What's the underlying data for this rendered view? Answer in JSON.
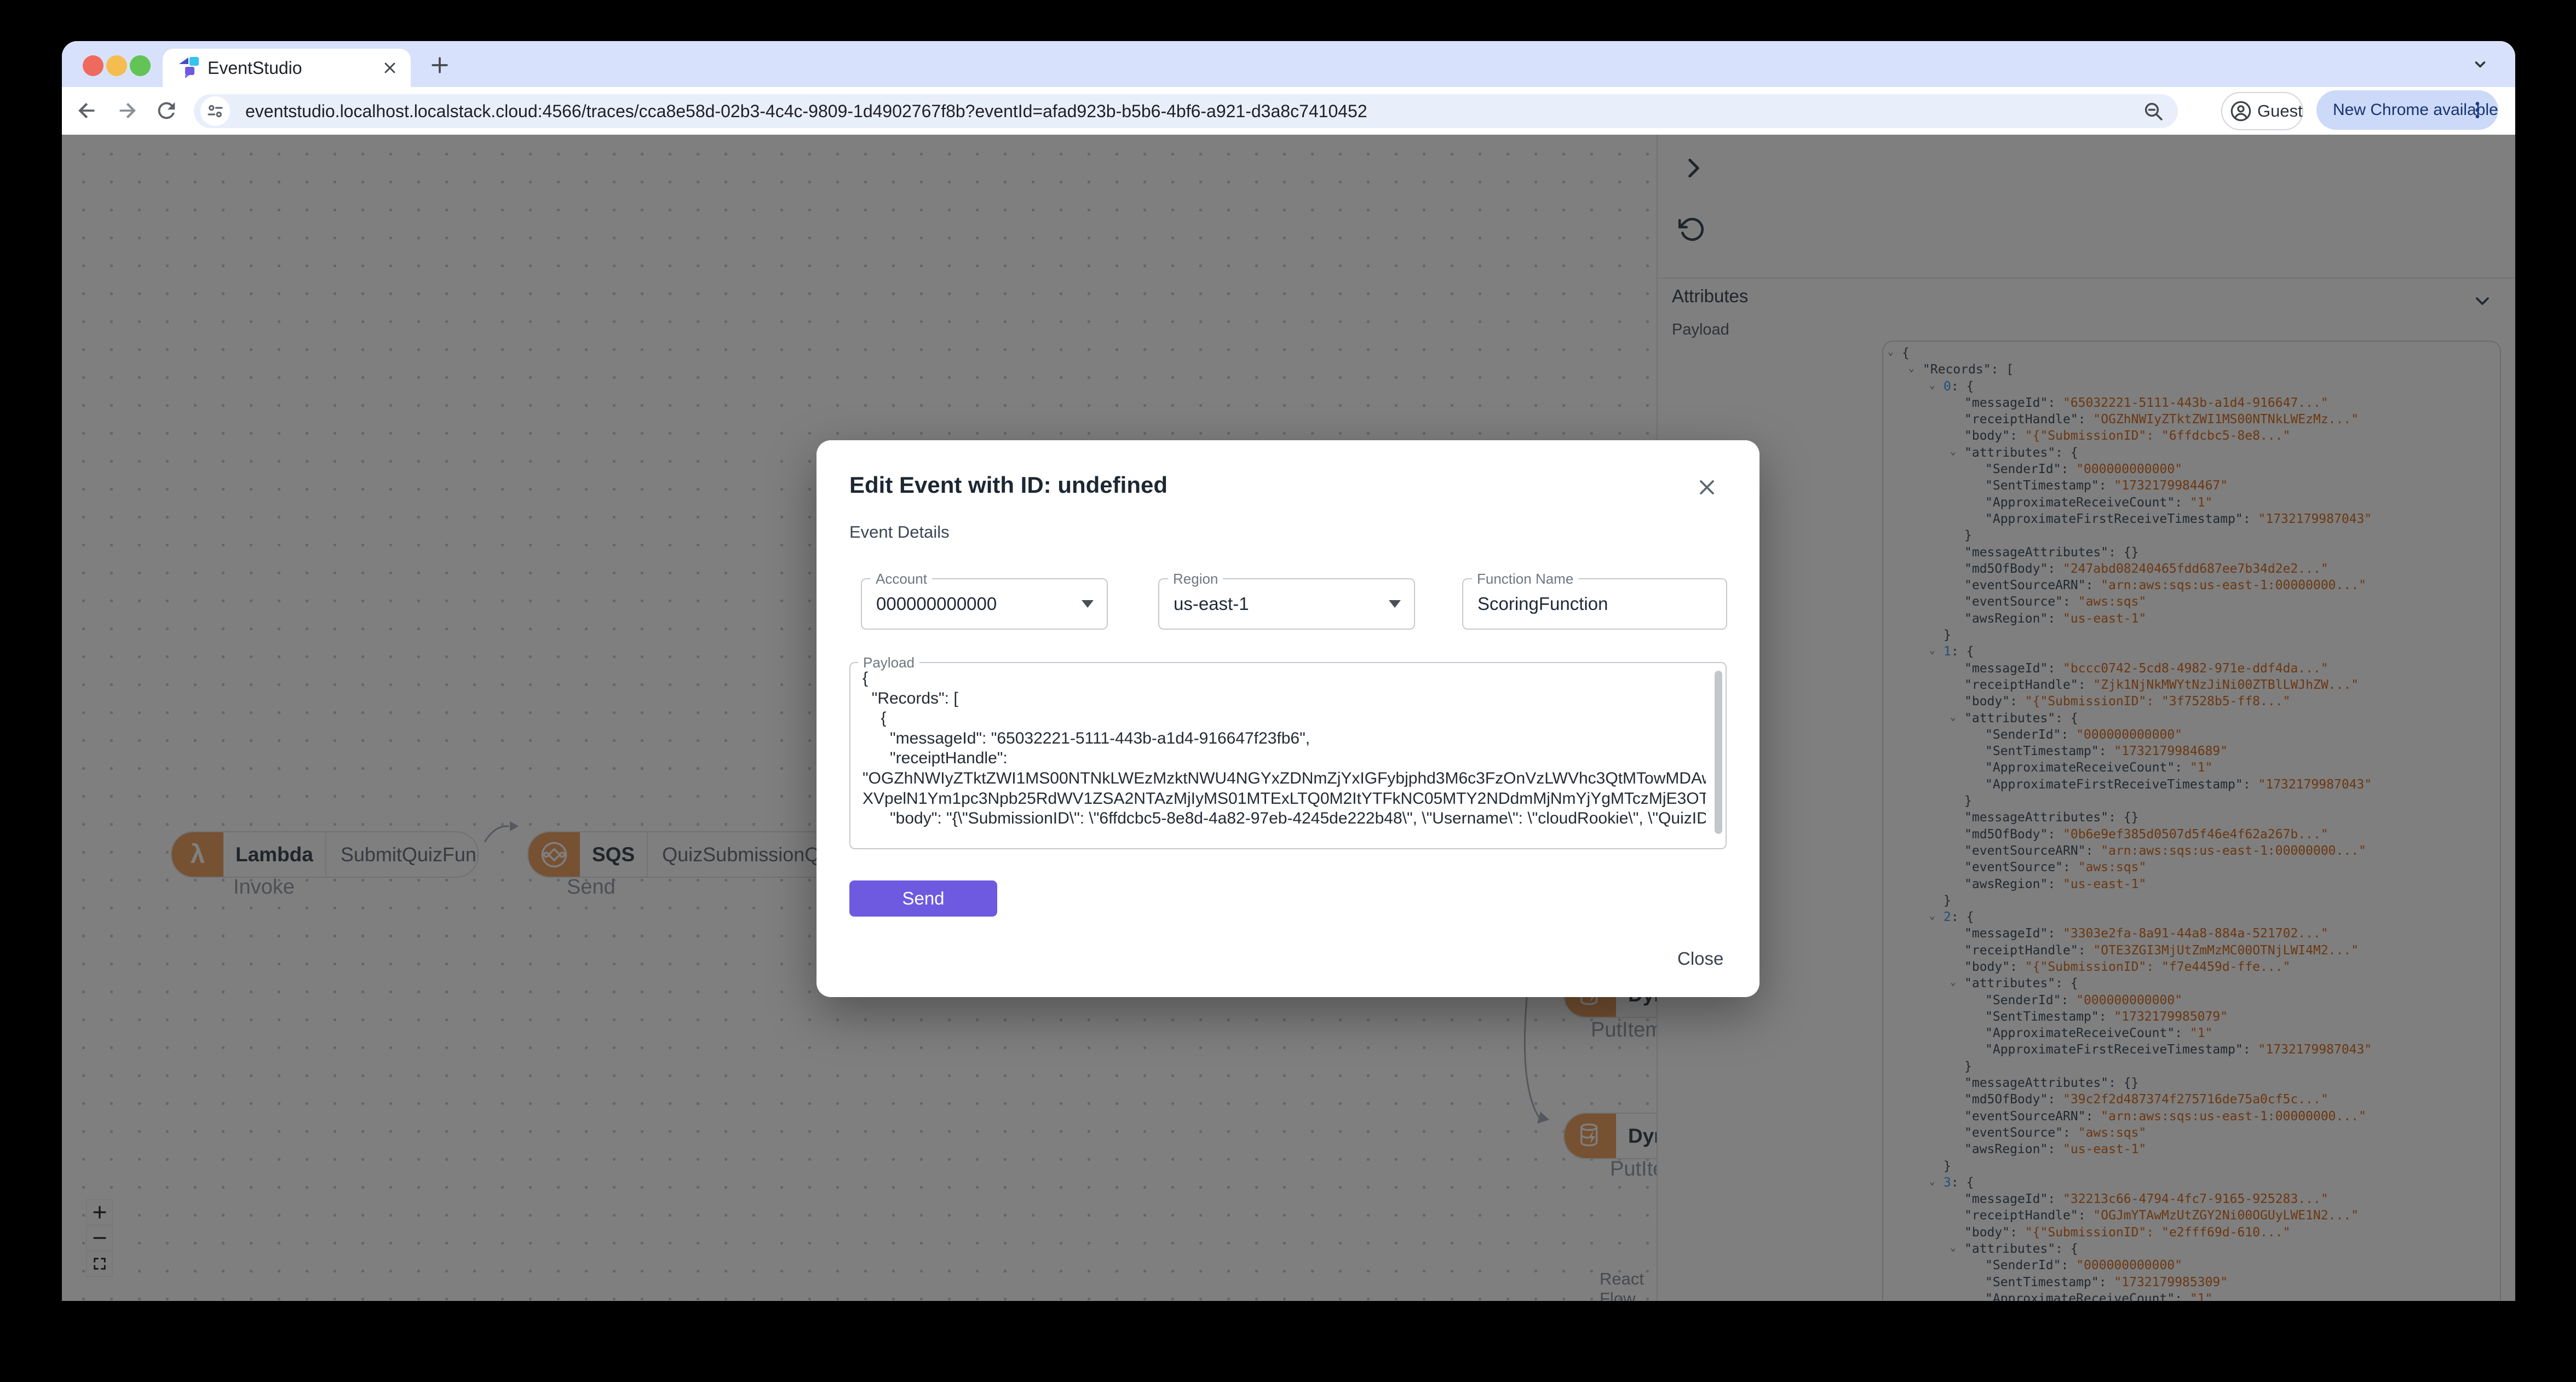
{
  "browser": {
    "tab_title": "EventStudio",
    "url": "eventstudio.localhost.localstack.cloud:4566/traces/cca8e58d-02b3-4c4c-9809-1d4902767f8b?eventId=afad923b-b5b6-4bf6-a921-d3a8c7410452",
    "profile_label": "Guest",
    "update_label": "New Chrome available"
  },
  "canvas": {
    "attribution": "React Flow",
    "nodes": [
      {
        "service": "Lambda",
        "name": "SubmitQuizFunction",
        "action": "Invoke"
      },
      {
        "service": "SQS",
        "name": "QuizSubmissionQueue",
        "action": "Send"
      },
      {
        "service": "DynamoDB",
        "name": "",
        "action": "PutItem"
      },
      {
        "service": "DynamoDB",
        "name": "",
        "action": "PutItem"
      }
    ]
  },
  "panel": {
    "attributes_label": "Attributes",
    "payload_label": "Payload",
    "json_lines": [
      {
        "ind": 0,
        "caret": true,
        "seg": [
          [
            "{",
            "b"
          ]
        ]
      },
      {
        "ind": 1,
        "caret": true,
        "seg": [
          [
            "\"Records\"",
            "k"
          ],
          [
            ": ",
            "p"
          ],
          [
            "[",
            "b"
          ]
        ]
      },
      {
        "ind": 2,
        "caret": true,
        "seg": [
          [
            "0",
            "i"
          ],
          [
            ": ",
            "p"
          ],
          [
            "{",
            "b"
          ]
        ]
      },
      {
        "ind": 3,
        "caret": false,
        "seg": [
          [
            "\"messageId\"",
            "k"
          ],
          [
            ": ",
            "p"
          ],
          [
            "\"65032221-5111-443b-a1d4-916647...\"",
            "v"
          ]
        ]
      },
      {
        "ind": 3,
        "caret": false,
        "seg": [
          [
            "\"receiptHandle\"",
            "k"
          ],
          [
            ": ",
            "p"
          ],
          [
            "\"OGZhNWIyZTktZWI1MS00NTNkLWEzMz...\"",
            "v"
          ]
        ]
      },
      {
        "ind": 3,
        "caret": false,
        "seg": [
          [
            "\"body\"",
            "k"
          ],
          [
            ": ",
            "p"
          ],
          [
            "\"{\"SubmissionID\": \"6ffdcbc5-8e8...\"",
            "v"
          ]
        ]
      },
      {
        "ind": 3,
        "caret": true,
        "seg": [
          [
            "\"attributes\"",
            "k"
          ],
          [
            ": ",
            "p"
          ],
          [
            "{",
            "b"
          ]
        ]
      },
      {
        "ind": 4,
        "caret": false,
        "seg": [
          [
            "\"SenderId\"",
            "k"
          ],
          [
            ": ",
            "p"
          ],
          [
            "\"000000000000\"",
            "v"
          ]
        ]
      },
      {
        "ind": 4,
        "caret": false,
        "seg": [
          [
            "\"SentTimestamp\"",
            "k"
          ],
          [
            ": ",
            "p"
          ],
          [
            "\"1732179984467\"",
            "v"
          ]
        ]
      },
      {
        "ind": 4,
        "caret": false,
        "seg": [
          [
            "\"ApproximateReceiveCount\"",
            "k"
          ],
          [
            ": ",
            "p"
          ],
          [
            "\"1\"",
            "v"
          ]
        ]
      },
      {
        "ind": 4,
        "caret": false,
        "seg": [
          [
            "\"ApproximateFirstReceiveTimestamp\"",
            "k"
          ],
          [
            ": ",
            "p"
          ],
          [
            "\"1732179987043\"",
            "v"
          ]
        ]
      },
      {
        "ind": 3,
        "caret": false,
        "seg": [
          [
            "}",
            "b"
          ]
        ]
      },
      {
        "ind": 3,
        "caret": false,
        "seg": [
          [
            "\"messageAttributes\"",
            "k"
          ],
          [
            ": ",
            "p"
          ],
          [
            "{}",
            "b"
          ]
        ]
      },
      {
        "ind": 3,
        "caret": false,
        "seg": [
          [
            "\"md5OfBody\"",
            "k"
          ],
          [
            ": ",
            "p"
          ],
          [
            "\"247abd08240465fdd687ee7b34d2e2...\"",
            "v"
          ]
        ]
      },
      {
        "ind": 3,
        "caret": false,
        "seg": [
          [
            "\"eventSourceARN\"",
            "k"
          ],
          [
            ": ",
            "p"
          ],
          [
            "\"arn:aws:sqs:us-east-1:00000000...\"",
            "v"
          ]
        ]
      },
      {
        "ind": 3,
        "caret": false,
        "seg": [
          [
            "\"eventSource\"",
            "k"
          ],
          [
            ": ",
            "p"
          ],
          [
            "\"aws:sqs\"",
            "v"
          ]
        ]
      },
      {
        "ind": 3,
        "caret": false,
        "seg": [
          [
            "\"awsRegion\"",
            "k"
          ],
          [
            ": ",
            "p"
          ],
          [
            "\"us-east-1\"",
            "v"
          ]
        ]
      },
      {
        "ind": 2,
        "caret": false,
        "seg": [
          [
            "}",
            "b"
          ]
        ]
      },
      {
        "ind": 2,
        "caret": true,
        "seg": [
          [
            "1",
            "i"
          ],
          [
            ": ",
            "p"
          ],
          [
            "{",
            "b"
          ]
        ]
      },
      {
        "ind": 3,
        "caret": false,
        "seg": [
          [
            "\"messageId\"",
            "k"
          ],
          [
            ": ",
            "p"
          ],
          [
            "\"bccc0742-5cd8-4982-971e-ddf4da...\"",
            "v"
          ]
        ]
      },
      {
        "ind": 3,
        "caret": false,
        "seg": [
          [
            "\"receiptHandle\"",
            "k"
          ],
          [
            ": ",
            "p"
          ],
          [
            "\"Zjk1NjNkMWYtNzJiNi00ZTBlLWJhZW...\"",
            "v"
          ]
        ]
      },
      {
        "ind": 3,
        "caret": false,
        "seg": [
          [
            "\"body\"",
            "k"
          ],
          [
            ": ",
            "p"
          ],
          [
            "\"{\"SubmissionID\": \"3f7528b5-ff8...\"",
            "v"
          ]
        ]
      },
      {
        "ind": 3,
        "caret": true,
        "seg": [
          [
            "\"attributes\"",
            "k"
          ],
          [
            ": ",
            "p"
          ],
          [
            "{",
            "b"
          ]
        ]
      },
      {
        "ind": 4,
        "caret": false,
        "seg": [
          [
            "\"SenderId\"",
            "k"
          ],
          [
            ": ",
            "p"
          ],
          [
            "\"000000000000\"",
            "v"
          ]
        ]
      },
      {
        "ind": 4,
        "caret": false,
        "seg": [
          [
            "\"SentTimestamp\"",
            "k"
          ],
          [
            ": ",
            "p"
          ],
          [
            "\"1732179984689\"",
            "v"
          ]
        ]
      },
      {
        "ind": 4,
        "caret": false,
        "seg": [
          [
            "\"ApproximateReceiveCount\"",
            "k"
          ],
          [
            ": ",
            "p"
          ],
          [
            "\"1\"",
            "v"
          ]
        ]
      },
      {
        "ind": 4,
        "caret": false,
        "seg": [
          [
            "\"ApproximateFirstReceiveTimestamp\"",
            "k"
          ],
          [
            ": ",
            "p"
          ],
          [
            "\"1732179987043\"",
            "v"
          ]
        ]
      },
      {
        "ind": 3,
        "caret": false,
        "seg": [
          [
            "}",
            "b"
          ]
        ]
      },
      {
        "ind": 3,
        "caret": false,
        "seg": [
          [
            "\"messageAttributes\"",
            "k"
          ],
          [
            ": ",
            "p"
          ],
          [
            "{}",
            "b"
          ]
        ]
      },
      {
        "ind": 3,
        "caret": false,
        "seg": [
          [
            "\"md5OfBody\"",
            "k"
          ],
          [
            ": ",
            "p"
          ],
          [
            "\"0b6e9ef385d0507d5f46e4f62a267b...\"",
            "v"
          ]
        ]
      },
      {
        "ind": 3,
        "caret": false,
        "seg": [
          [
            "\"eventSourceARN\"",
            "k"
          ],
          [
            ": ",
            "p"
          ],
          [
            "\"arn:aws:sqs:us-east-1:00000000...\"",
            "v"
          ]
        ]
      },
      {
        "ind": 3,
        "caret": false,
        "seg": [
          [
            "\"eventSource\"",
            "k"
          ],
          [
            ": ",
            "p"
          ],
          [
            "\"aws:sqs\"",
            "v"
          ]
        ]
      },
      {
        "ind": 3,
        "caret": false,
        "seg": [
          [
            "\"awsRegion\"",
            "k"
          ],
          [
            ": ",
            "p"
          ],
          [
            "\"us-east-1\"",
            "v"
          ]
        ]
      },
      {
        "ind": 2,
        "caret": false,
        "seg": [
          [
            "}",
            "b"
          ]
        ]
      },
      {
        "ind": 2,
        "caret": true,
        "seg": [
          [
            "2",
            "i"
          ],
          [
            ": ",
            "p"
          ],
          [
            "{",
            "b"
          ]
        ]
      },
      {
        "ind": 3,
        "caret": false,
        "seg": [
          [
            "\"messageId\"",
            "k"
          ],
          [
            ": ",
            "p"
          ],
          [
            "\"3303e2fa-8a91-44a8-884a-521702...\"",
            "v"
          ]
        ]
      },
      {
        "ind": 3,
        "caret": false,
        "seg": [
          [
            "\"receiptHandle\"",
            "k"
          ],
          [
            ": ",
            "p"
          ],
          [
            "\"OTE3ZGI3MjUtZmMzMC00OTNjLWI4M2...\"",
            "v"
          ]
        ]
      },
      {
        "ind": 3,
        "caret": false,
        "seg": [
          [
            "\"body\"",
            "k"
          ],
          [
            ": ",
            "p"
          ],
          [
            "\"{\"SubmissionID\": \"f7e4459d-ffe...\"",
            "v"
          ]
        ]
      },
      {
        "ind": 3,
        "caret": true,
        "seg": [
          [
            "\"attributes\"",
            "k"
          ],
          [
            ": ",
            "p"
          ],
          [
            "{",
            "b"
          ]
        ]
      },
      {
        "ind": 4,
        "caret": false,
        "seg": [
          [
            "\"SenderId\"",
            "k"
          ],
          [
            ": ",
            "p"
          ],
          [
            "\"000000000000\"",
            "v"
          ]
        ]
      },
      {
        "ind": 4,
        "caret": false,
        "seg": [
          [
            "\"SentTimestamp\"",
            "k"
          ],
          [
            ": ",
            "p"
          ],
          [
            "\"1732179985079\"",
            "v"
          ]
        ]
      },
      {
        "ind": 4,
        "caret": false,
        "seg": [
          [
            "\"ApproximateReceiveCount\"",
            "k"
          ],
          [
            ": ",
            "p"
          ],
          [
            "\"1\"",
            "v"
          ]
        ]
      },
      {
        "ind": 4,
        "caret": false,
        "seg": [
          [
            "\"ApproximateFirstReceiveTimestamp\"",
            "k"
          ],
          [
            ": ",
            "p"
          ],
          [
            "\"1732179987043\"",
            "v"
          ]
        ]
      },
      {
        "ind": 3,
        "caret": false,
        "seg": [
          [
            "}",
            "b"
          ]
        ]
      },
      {
        "ind": 3,
        "caret": false,
        "seg": [
          [
            "\"messageAttributes\"",
            "k"
          ],
          [
            ": ",
            "p"
          ],
          [
            "{}",
            "b"
          ]
        ]
      },
      {
        "ind": 3,
        "caret": false,
        "seg": [
          [
            "\"md5OfBody\"",
            "k"
          ],
          [
            ": ",
            "p"
          ],
          [
            "\"39c2f2d487374f275716de75a0cf5c...\"",
            "v"
          ]
        ]
      },
      {
        "ind": 3,
        "caret": false,
        "seg": [
          [
            "\"eventSourceARN\"",
            "k"
          ],
          [
            ": ",
            "p"
          ],
          [
            "\"arn:aws:sqs:us-east-1:00000000...\"",
            "v"
          ]
        ]
      },
      {
        "ind": 3,
        "caret": false,
        "seg": [
          [
            "\"eventSource\"",
            "k"
          ],
          [
            ": ",
            "p"
          ],
          [
            "\"aws:sqs\"",
            "v"
          ]
        ]
      },
      {
        "ind": 3,
        "caret": false,
        "seg": [
          [
            "\"awsRegion\"",
            "k"
          ],
          [
            ": ",
            "p"
          ],
          [
            "\"us-east-1\"",
            "v"
          ]
        ]
      },
      {
        "ind": 2,
        "caret": false,
        "seg": [
          [
            "}",
            "b"
          ]
        ]
      },
      {
        "ind": 2,
        "caret": true,
        "seg": [
          [
            "3",
            "i"
          ],
          [
            ": ",
            "p"
          ],
          [
            "{",
            "b"
          ]
        ]
      },
      {
        "ind": 3,
        "caret": false,
        "seg": [
          [
            "\"messageId\"",
            "k"
          ],
          [
            ": ",
            "p"
          ],
          [
            "\"32213c66-4794-4fc7-9165-925283...\"",
            "v"
          ]
        ]
      },
      {
        "ind": 3,
        "caret": false,
        "seg": [
          [
            "\"receiptHandle\"",
            "k"
          ],
          [
            ": ",
            "p"
          ],
          [
            "\"OGJmYTAwMzUtZGY2Ni00OGUyLWE1N2...\"",
            "v"
          ]
        ]
      },
      {
        "ind": 3,
        "caret": false,
        "seg": [
          [
            "\"body\"",
            "k"
          ],
          [
            ": ",
            "p"
          ],
          [
            "\"{\"SubmissionID\": \"e2fff69d-610...\"",
            "v"
          ]
        ]
      },
      {
        "ind": 3,
        "caret": true,
        "seg": [
          [
            "\"attributes\"",
            "k"
          ],
          [
            ": ",
            "p"
          ],
          [
            "{",
            "b"
          ]
        ]
      },
      {
        "ind": 4,
        "caret": false,
        "seg": [
          [
            "\"SenderId\"",
            "k"
          ],
          [
            ": ",
            "p"
          ],
          [
            "\"000000000000\"",
            "v"
          ]
        ]
      },
      {
        "ind": 4,
        "caret": false,
        "seg": [
          [
            "\"SentTimestamp\"",
            "k"
          ],
          [
            ": ",
            "p"
          ],
          [
            "\"1732179985309\"",
            "v"
          ]
        ]
      },
      {
        "ind": 4,
        "caret": false,
        "seg": [
          [
            "\"ApproximateReceiveCount\"",
            "k"
          ],
          [
            ": ",
            "p"
          ],
          [
            "\"1\"",
            "v"
          ]
        ]
      }
    ]
  },
  "modal": {
    "title": "Edit Event with ID: undefined",
    "section_title": "Event Details",
    "fields": {
      "account": {
        "label": "Account",
        "value": "000000000000"
      },
      "region": {
        "label": "Region",
        "value": "us-east-1"
      },
      "function_name": {
        "label": "Function Name",
        "value": "ScoringFunction"
      }
    },
    "payload": {
      "label": "Payload",
      "text": "{\n  \"Records\": [\n    {\n      \"messageId\": \"65032221-5111-443b-a1d4-916647f23fb6\",\n      \"receiptHandle\":\n\"OGZhNWIyZTktZWI1MS00NTNkLWEzMzktNWU4NGYxZDNmZjYxIGFybjphd3M6c3FzOnVzLWVhc3QtMTowMDAwMDAwMDAwMDA6U\nXVpelN1Ym1pc3Npb25RdWV1ZSA2NTAzMjIyMS01MTExLTQ0M2ItYTFkNC05MTY2NDdmMjNmYjYgMTczMjE3OTk4Ny4wNDMwMTU3\",\n      \"body\": \"{\\\"SubmissionID\\\": \\\"6ffdcbc5-8e8d-4a82-97eb-4245de222b48\\\", \\\"Username\\\": \\\"cloudRookie\\\", \\\"QuizID\\\": \\\"adorable-"
    },
    "send_label": "Send",
    "close_label": "Close"
  },
  "colors": {
    "accent_purple": "#6e5ae0",
    "aws_icon_orange": "#eda265",
    "json_key": "#46535f",
    "json_value": "#d96f22",
    "json_index": "#3fa0f5",
    "update_pill": "#ccd9f9"
  }
}
